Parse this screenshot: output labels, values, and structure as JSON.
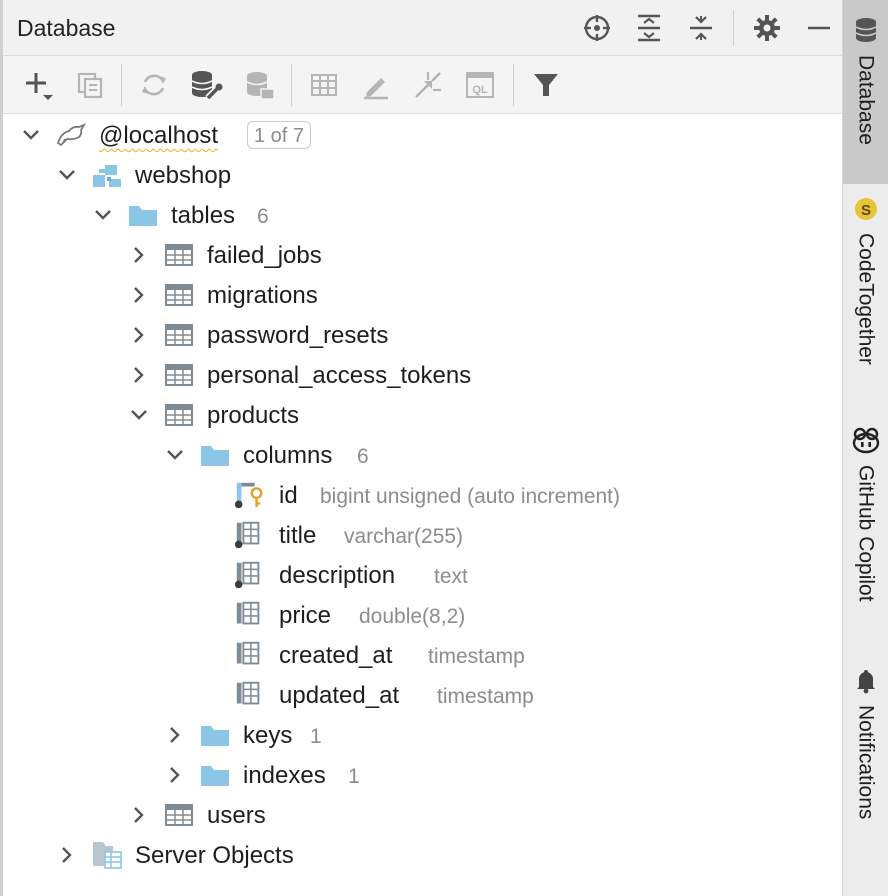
{
  "header": {
    "title": "Database"
  },
  "tree": {
    "datasource": {
      "label": "@localhost",
      "badge": "1 of 7"
    },
    "schema": {
      "label": "webshop"
    },
    "tables_folder": {
      "label": "tables",
      "count": "6"
    },
    "tables": [
      {
        "label": "failed_jobs"
      },
      {
        "label": "migrations"
      },
      {
        "label": "password_resets"
      },
      {
        "label": "personal_access_tokens"
      },
      {
        "label": "products"
      }
    ],
    "columns_folder": {
      "label": "columns",
      "count": "6"
    },
    "columns": [
      {
        "name": "id",
        "type": "bigint unsigned (auto increment)"
      },
      {
        "name": "title",
        "type": "varchar(255)"
      },
      {
        "name": "description",
        "type": "text"
      },
      {
        "name": "price",
        "type": "double(8,2)"
      },
      {
        "name": "created_at",
        "type": "timestamp"
      },
      {
        "name": "updated_at",
        "type": "timestamp"
      }
    ],
    "keys_folder": {
      "label": "keys",
      "count": "1"
    },
    "indexes_folder": {
      "label": "indexes",
      "count": "1"
    },
    "users": {
      "label": "users"
    },
    "server_objects": {
      "label": "Server Objects"
    }
  },
  "side_tabs": [
    {
      "label": "Database"
    },
    {
      "label": "CodeTogether"
    },
    {
      "label": "GitHub Copilot"
    },
    {
      "label": "Notifications"
    }
  ],
  "colors": {
    "folder": "#8cc6e6",
    "accent_key": "#e0a32c",
    "icon_gray": "#6c6c6c",
    "disabled_gray": "#b5b5b5"
  }
}
